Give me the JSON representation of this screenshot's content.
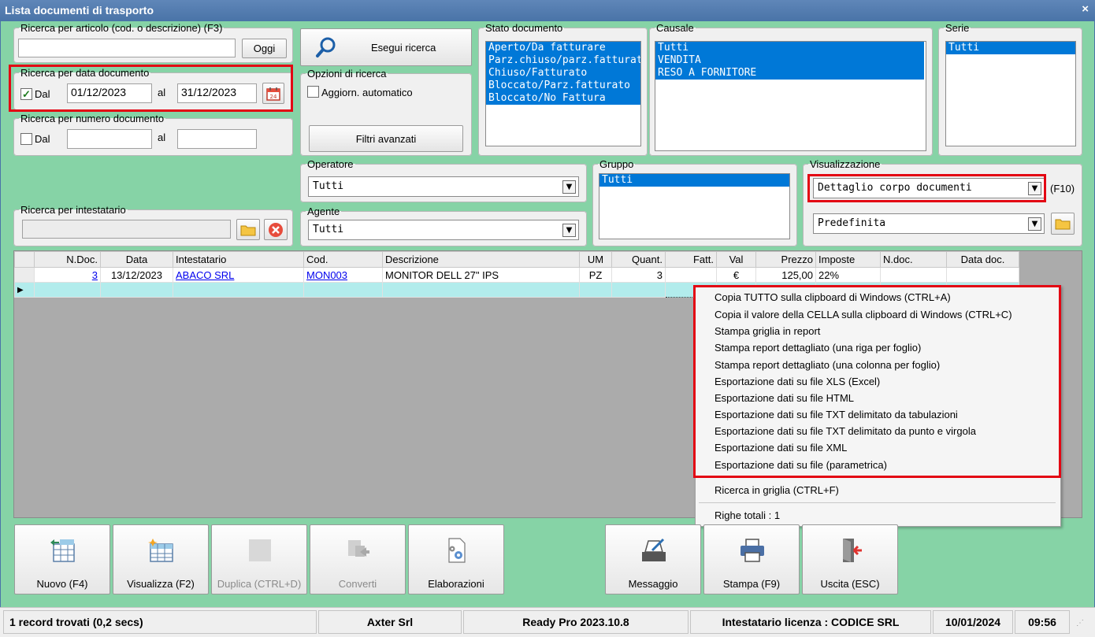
{
  "window": {
    "title": "Lista documenti di trasporto",
    "close": "×"
  },
  "search_article": {
    "legend": "Ricerca per articolo (cod. o descrizione) (F3)",
    "value": "",
    "today_button": "Oggi"
  },
  "execute_search": {
    "label": "Esegui ricerca"
  },
  "date_search": {
    "legend": "Ricerca per data documento",
    "checked": true,
    "check_mark": "✓",
    "from_label": "Dal",
    "from": "01/12/2023",
    "to_label": "al",
    "to": "31/12/2023",
    "calendar_text": "24"
  },
  "number_search": {
    "legend": "Ricerca per numero documento",
    "checked": false,
    "from_label": "Dal",
    "from": "",
    "to_label": "al",
    "to": ""
  },
  "search_options": {
    "legend": "Opzioni di ricerca",
    "auto_update": "Aggiorn. automatico",
    "advanced_filters": "Filtri avanzati"
  },
  "doc_state": {
    "legend": "Stato documento",
    "items": [
      "Aperto/Da fatturare",
      "Parz.chiuso/parz.fatturato",
      "Chiuso/Fatturato",
      "Bloccato/Parz.fatturato",
      "Bloccato/No Fattura"
    ]
  },
  "causale": {
    "legend": "Causale",
    "items": [
      "Tutti",
      "VENDITA",
      "RESO A FORNITORE"
    ]
  },
  "serie": {
    "legend": "Serie",
    "items": [
      "Tutti"
    ]
  },
  "operator": {
    "legend": "Operatore",
    "value": "Tutti"
  },
  "agent": {
    "legend": "Agente",
    "value": "Tutti"
  },
  "group": {
    "legend": "Gruppo",
    "items": [
      "Tutti"
    ]
  },
  "view": {
    "legend": "Visualizzazione",
    "mode": "Dettaglio corpo documenti",
    "hotkey": "(F10)",
    "layout": "Predefinita"
  },
  "holder_search": {
    "legend": "Ricerca per intestatario",
    "value": ""
  },
  "grid": {
    "columns": [
      "N.Doc.",
      "Data",
      "Intestatario",
      "Cod.",
      "Descrizione",
      "UM",
      "Quant.",
      "Fatt.",
      "Val",
      "Prezzo",
      "Imposte",
      "N.doc.",
      "Data doc."
    ],
    "rows": [
      {
        "ndoc": "3",
        "data": "13/12/2023",
        "intestatario": "ABACO SRL",
        "cod": "MON003",
        "descrizione": "MONITOR DELL 27\" IPS",
        "um": "PZ",
        "quant": "3",
        "fatt": "",
        "val": "€",
        "prezzo": "125,00",
        "imposte": "22%",
        "ndoc2": "",
        "datadoc": ""
      }
    ],
    "row_indicator": "▶"
  },
  "context_menu": {
    "items": [
      "Copia TUTTO sulla clipboard di Windows (CTRL+A)",
      "Copia il valore della CELLA sulla clipboard di Windows (CTRL+C)",
      "Stampa griglia in report",
      "Stampa report dettagliato (una riga per foglio)",
      "Stampa report dettagliato (una colonna per foglio)",
      "Esportazione dati su file XLS (Excel)",
      "Esportazione dati su file HTML",
      "Esportazione dati su file TXT delimitato da tabulazioni",
      "Esportazione dati su file TXT delimitato da punto e virgola",
      "Esportazione dati su file XML",
      "Esportazione dati su file (parametrica)"
    ],
    "search": "Ricerca in griglia (CTRL+F)",
    "total_rows": "Righe totali : 1"
  },
  "buttons": {
    "new": "Nuovo (F4)",
    "view": "Visualizza (F2)",
    "duplicate": "Duplica (CTRL+D)",
    "convert": "Converti",
    "processing": "Elaborazioni",
    "message": "Messaggio",
    "print": "Stampa (F9)",
    "exit": "Uscita (ESC)"
  },
  "status": {
    "records": "1 record trovati (0,2 secs)",
    "company": "Axter Srl",
    "version": "Ready Pro 2023.10.8",
    "license": "Intestatario licenza : CODICE SRL",
    "date": "10/01/2024",
    "time": "09:56"
  },
  "colors": {
    "accent": "#0078d7",
    "background": "#86d3a6",
    "highlight": "#e30613",
    "titlebar": "#4a74a8"
  }
}
